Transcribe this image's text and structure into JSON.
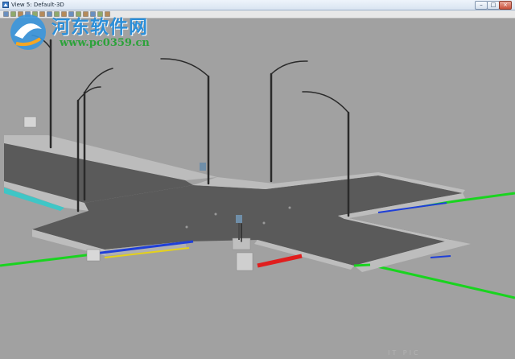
{
  "window": {
    "title": "View 5: Default-3D",
    "buttons": {
      "minimize": "–",
      "maximize": "□",
      "close": "×"
    }
  },
  "toolbar": {
    "icons": [
      "select-icon",
      "zoom-icon",
      "pan-icon",
      "orbit-icon",
      "zoom-extents-icon",
      "grid-icon",
      "shade-icon",
      "layer-icon",
      "settings-icon",
      "camera-icon",
      "light-icon",
      "view-icon",
      "measure-icon",
      "render-icon",
      "help-icon"
    ]
  },
  "watermark": {
    "name": "河东软件网",
    "url": "www.pc0359.cn"
  },
  "colors": {
    "background": "#a1a1a1",
    "road_surface": "#5a5a5a",
    "curb": "#bdbdbd",
    "green_pipe": "#19d41f",
    "blue_pipe": "#1f3fd8",
    "red_pipe": "#e01e1e",
    "yellow_pipe": "#e6d21a",
    "cyan_edge": "#3fc6c6"
  },
  "scene": {
    "street_lights": 7,
    "description_label": ""
  },
  "faint_mark": "IT   PIC"
}
